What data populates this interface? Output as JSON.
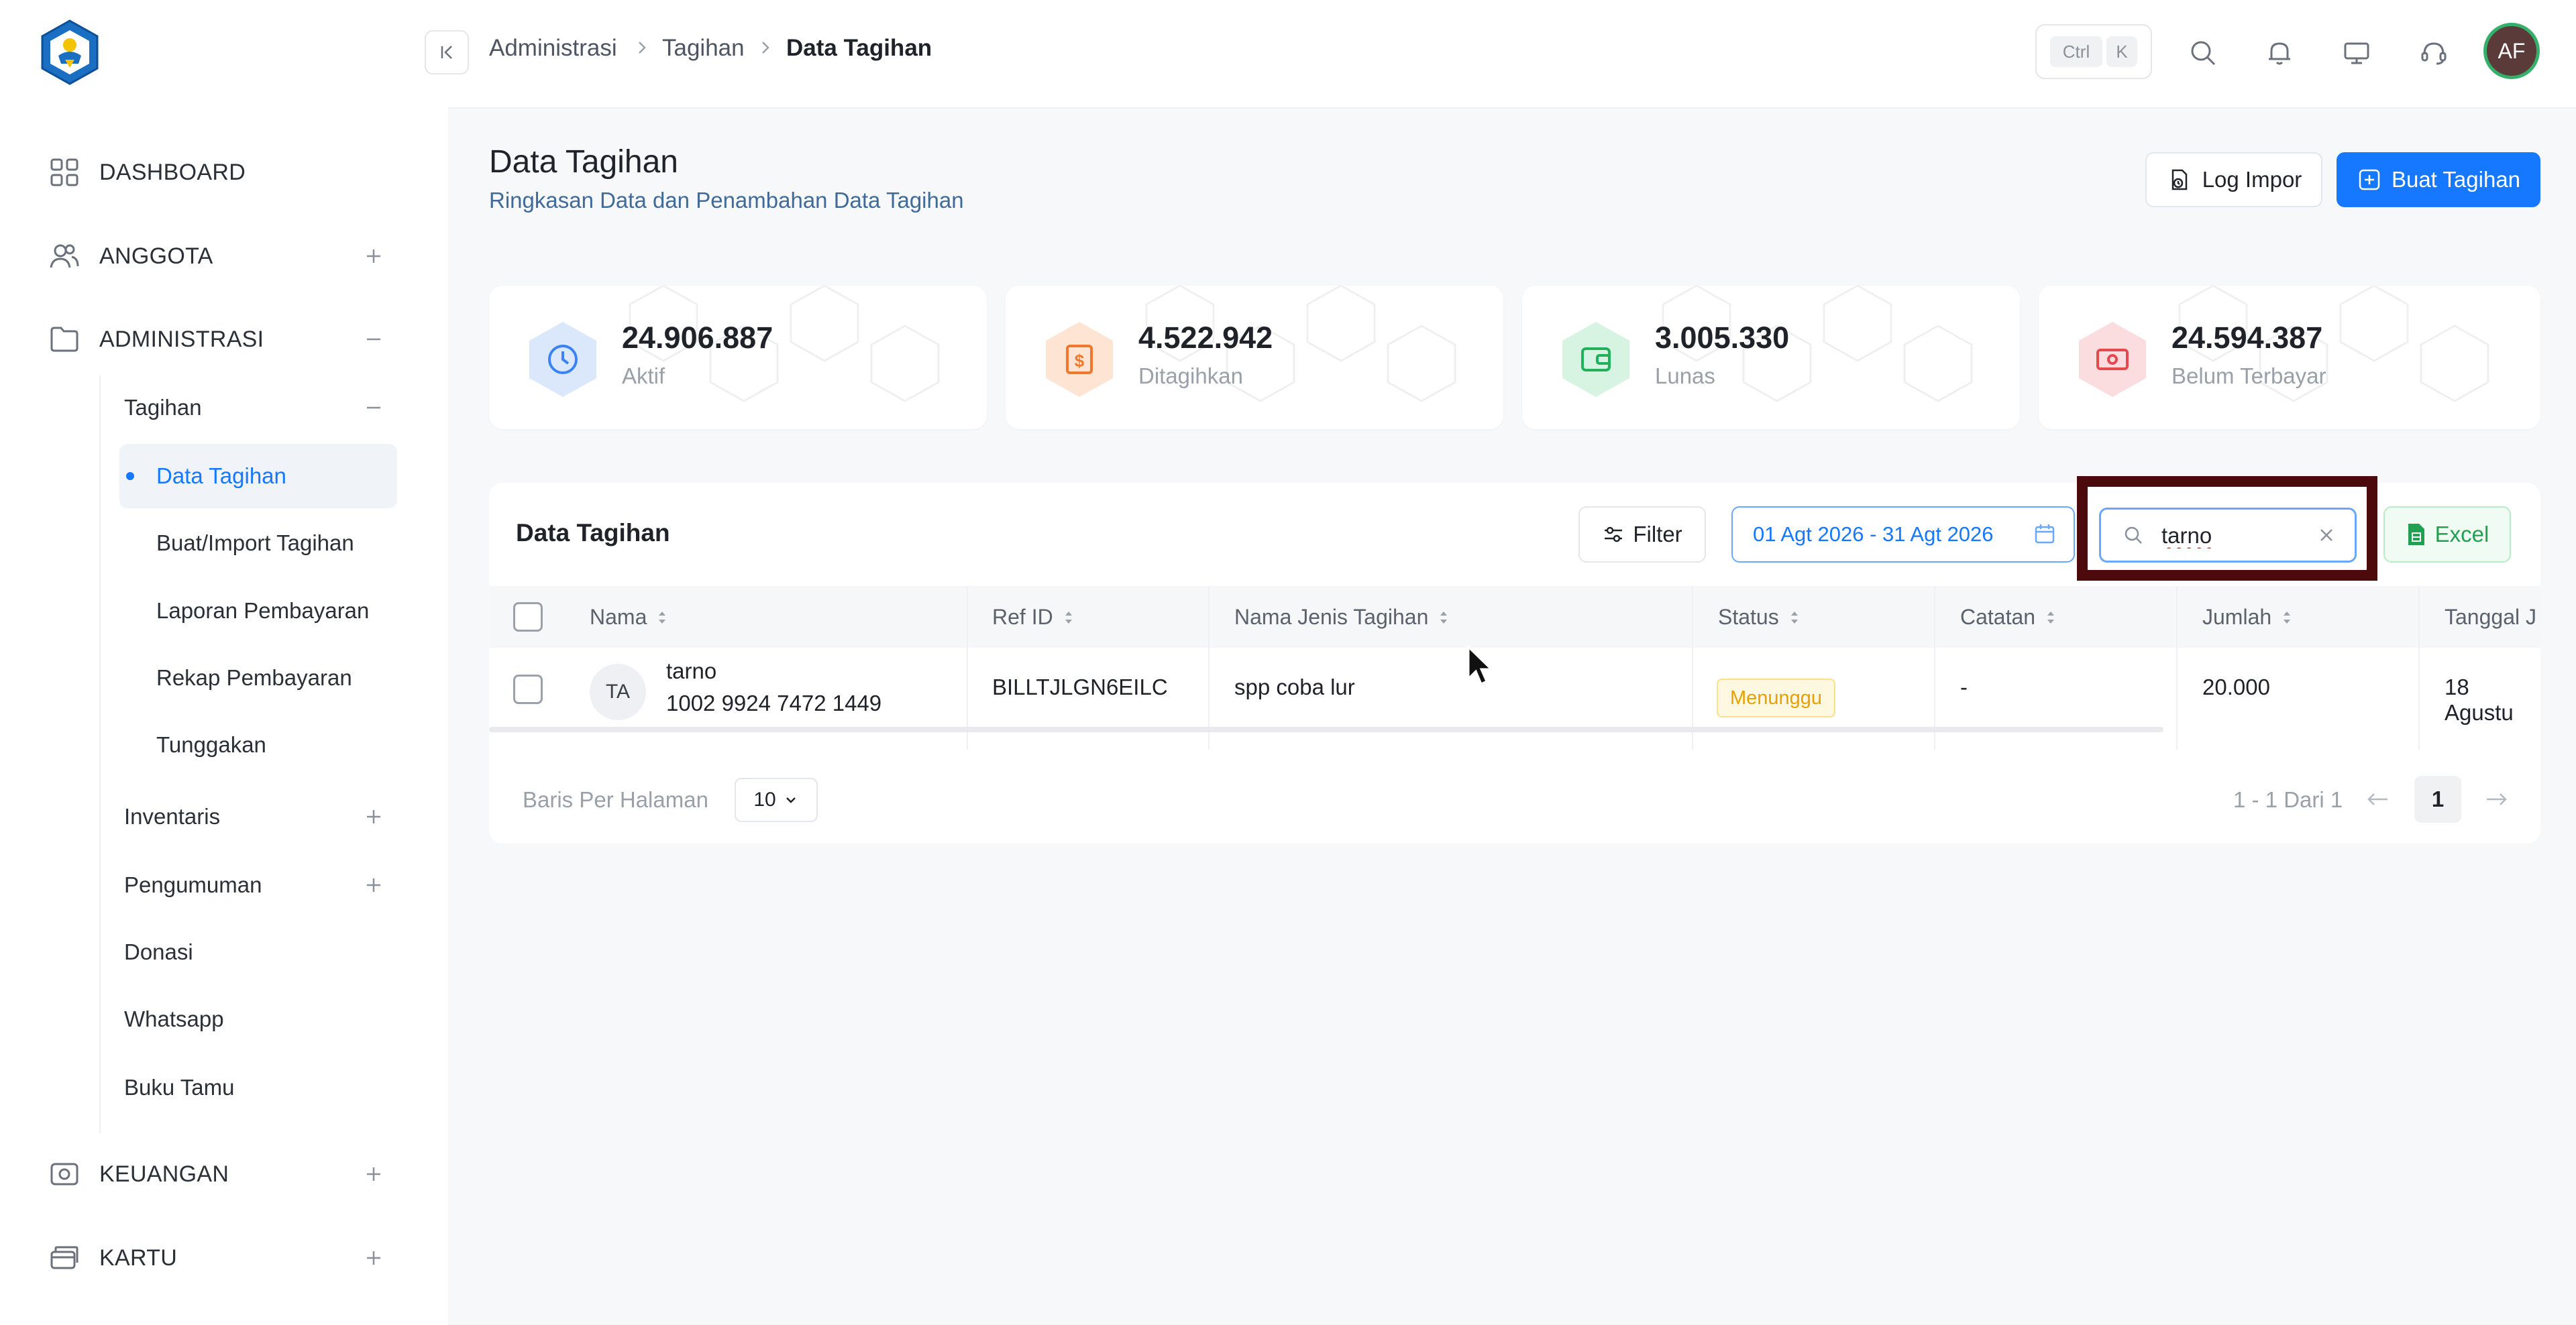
{
  "sidebar": {
    "items": [
      {
        "label": "DASHBOARD",
        "icon": "grid-icon"
      },
      {
        "label": "ANGGOTA",
        "icon": "users-icon"
      },
      {
        "label": "ADMINISTRASI",
        "icon": "folder-icon"
      },
      {
        "label": "KEUANGAN",
        "icon": "camera-icon"
      },
      {
        "label": "KARTU",
        "icon": "cards-icon"
      }
    ],
    "administrasi_sub": [
      {
        "label": "Tagihan"
      },
      {
        "label": "Inventaris"
      },
      {
        "label": "Pengumuman"
      },
      {
        "label": "Donasi"
      },
      {
        "label": "Whatsapp"
      },
      {
        "label": "Buku Tamu"
      }
    ],
    "tagihan_sub": [
      {
        "label": "Data Tagihan",
        "active": true
      },
      {
        "label": "Buat/Import Tagihan"
      },
      {
        "label": "Laporan Pembayaran"
      },
      {
        "label": "Rekap Pembayaran"
      },
      {
        "label": "Tunggakan"
      }
    ]
  },
  "breadcrumb": [
    "Administrasi",
    "Tagihan",
    "Data Tagihan"
  ],
  "topbar": {
    "kbd": [
      "Ctrl",
      "K"
    ],
    "avatar_initials": "AF"
  },
  "header": {
    "title": "Data Tagihan",
    "subtitle": "Ringkasan Data dan Penambahan Data Tagihan",
    "log_impor_label": "Log Impor",
    "buat_tagihan_label": "Buat Tagihan"
  },
  "stats": [
    {
      "value": "24.906.887",
      "label": "Aktif",
      "color": "#3b82f6",
      "bg": "#dbe8fc"
    },
    {
      "value": "4.522.942",
      "label": "Ditagihkan",
      "color": "#f0772b",
      "bg": "#fde4d3"
    },
    {
      "value": "3.005.330",
      "label": "Lunas",
      "color": "#22b05a",
      "bg": "#d7f4e2"
    },
    {
      "value": "24.594.387",
      "label": "Belum Terbayar",
      "color": "#e5484d",
      "bg": "#fbdde0"
    }
  ],
  "table": {
    "title": "Data Tagihan",
    "filter_label": "Filter",
    "date_range": "01 Agt 2026 - 31 Agt 2026",
    "search_value": "tarno",
    "excel_label": "Excel",
    "columns": [
      "Nama",
      "Ref ID",
      "Nama Jenis Tagihan",
      "Status",
      "Catatan",
      "Jumlah",
      "Tanggal J"
    ],
    "rows": [
      {
        "initials": "TA",
        "name": "tarno",
        "id_number": "1002 9924 7472 1449",
        "ref_id": "BILLTJLGN6EILC",
        "jenis": "spp coba lur",
        "status": "Menunggu",
        "catatan": "-",
        "jumlah": "20.000",
        "tanggal": "18 Agustu"
      }
    ],
    "rows_per_page_label": "Baris Per Halaman",
    "rows_per_page": "10",
    "pager_info": "1 - 1 Dari 1",
    "current_page": "1"
  }
}
